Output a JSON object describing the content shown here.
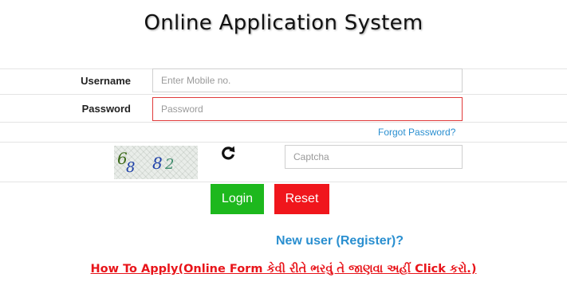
{
  "page": {
    "title": "Online Application System"
  },
  "form": {
    "username_label": "Username",
    "username_placeholder": "Enter Mobile no.",
    "username_value": "",
    "password_label": "Password",
    "password_placeholder": "Password",
    "password_value": "",
    "forgot_password": "Forgot Password?",
    "captcha_image_text": "6 8 8 2",
    "captcha_placeholder": "Captcha",
    "captcha_value": "",
    "refresh_icon": "refresh-icon",
    "login_label": "Login",
    "reset_label": "Reset"
  },
  "links": {
    "new_user": "New user (Register)?",
    "how_to_apply": "How To Apply(Online Form કેવી રીતે ભરવું તે જાણવા અહીં Click કરો.)"
  },
  "colors": {
    "login_button": "#1db81d",
    "reset_button": "#f0161c",
    "link_blue": "#2a8fd0",
    "link_red": "#e8141a",
    "invalid_border": "#e03a3a"
  }
}
